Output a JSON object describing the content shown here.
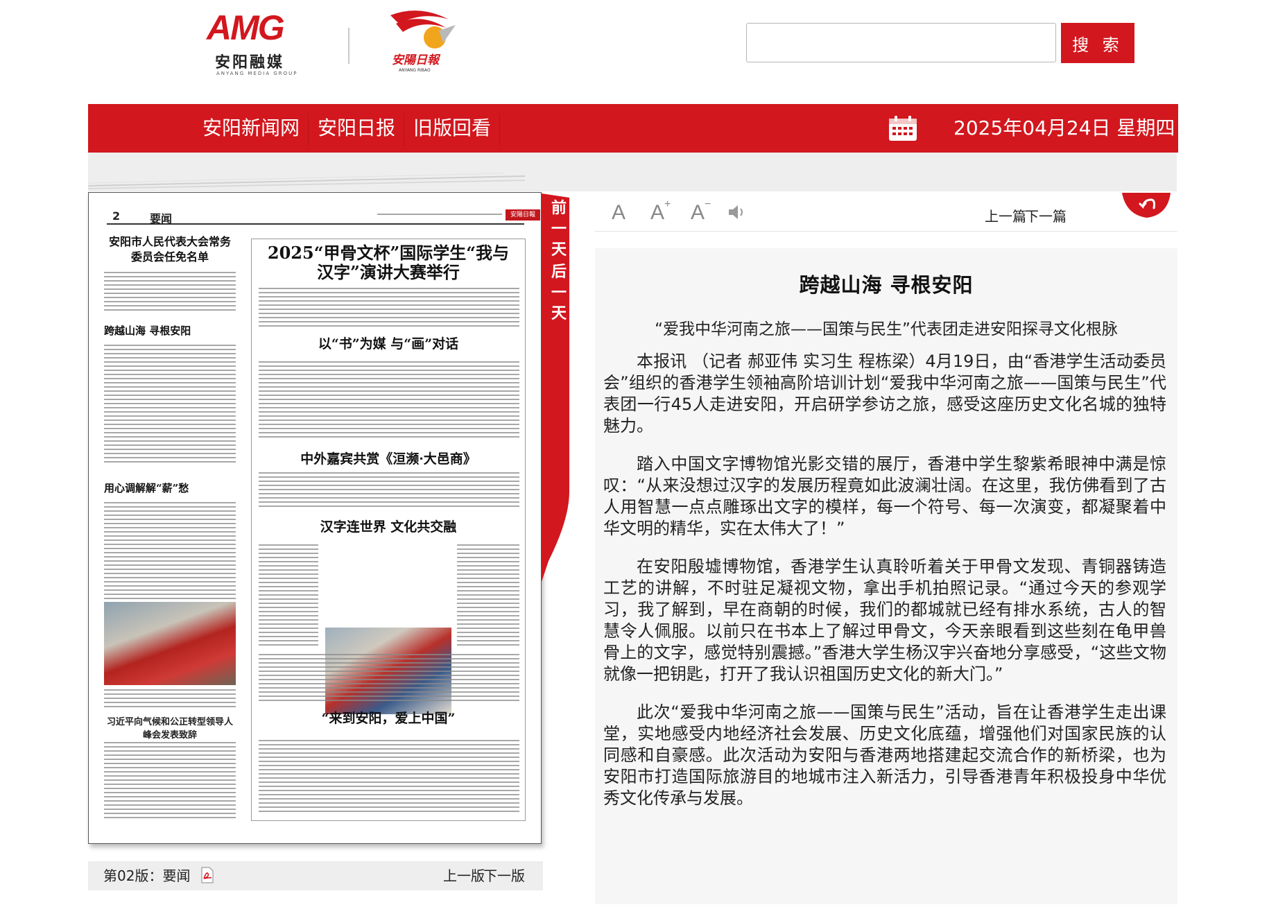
{
  "header": {
    "logo_amg_mark": "AMG",
    "logo_amg_cn": "安阳融媒",
    "logo_amg_en": "ANYANG MEDIA GROUP",
    "logo_ribao_cn": "安陽日報",
    "logo_ribao_en": "ANYANG RIBAO",
    "search_placeholder": "",
    "search_button": "搜 索"
  },
  "nav": {
    "items": [
      "安阳新闻网",
      "安阳日报",
      "旧版回看"
    ],
    "date": "2025年04月24日 星期四",
    "calendar_icon": "calendar-icon"
  },
  "side_tab": {
    "prev_day": [
      "前",
      "一",
      "天"
    ],
    "next_day": [
      "后",
      "一",
      "天"
    ]
  },
  "newspaper": {
    "page_num": "2",
    "section": "要闻",
    "left_headline_1": "安阳市人民代表大会常务委员会任免名单",
    "left_headline_2": "跨越山海 寻根安阳",
    "left_headline_3": "用心调解解“薪”愁",
    "left_headline_4": "习近平向气候和公正转型领导人峰会发表致辞",
    "box_headline_1": "2025“甲骨文杯”国际学生“我与汉字”演讲大赛举行",
    "box_headline_2": "以“书”为媒 与“画”对话",
    "box_headline_3": "中外嘉宾共赏《洹濒·大邑商》",
    "box_headline_4": "汉字连世界 文化共交融",
    "box_headline_5": "“来到安阳，爱上中国”",
    "colors": {
      "accent": "#d2171e"
    }
  },
  "page_footer": {
    "label": "第02版：要闻",
    "pdf_icon": "pdf-icon",
    "prev": "上一版",
    "next": "下一版"
  },
  "article_tools": {
    "font_default": "A",
    "font_larger": "A",
    "font_larger_sup": "+",
    "font_smaller": "A",
    "font_smaller_sup": "−",
    "speaker_icon": "speaker-icon",
    "prev": "上一篇",
    "next": "下一篇",
    "back_icon": "back-arrow-icon"
  },
  "article": {
    "title": "跨越山海 寻根安阳",
    "subtitle": "“爱我中华河南之旅——国策与民生”代表团走进安阳探寻文化根脉",
    "paragraphs": [
      "本报讯 （记者 郝亚伟 实习生 程栋梁）4月19日，由“香港学生活动委员会”组织的香港学生领袖高阶培训计划“爱我中华河南之旅——国策与民生”代表团一行45人走进安阳，开启研学参访之旅，感受这座历史文化名城的独特魅力。",
      "踏入中国文字博物馆光影交错的展厅，香港中学生黎紫希眼神中满是惊叹：“从来没想过汉字的发展历程竟如此波澜壮阔。在这里，我仿佛看到了古人用智慧一点点雕琢出文字的模样，每一个符号、每一次演变，都凝聚着中华文明的精华，实在太伟大了！”",
      "在安阳殷墟博物馆，香港学生认真聆听着关于甲骨文发现、青铜器铸造工艺的讲解，不时驻足凝视文物，拿出手机拍照记录。“通过今天的参观学习，我了解到，早在商朝的时候，我们的都城就已经有排水系统，古人的智慧令人佩服。以前只在书本上了解过甲骨文，今天亲眼看到这些刻在龟甲兽骨上的文字，感觉特别震撼。”香港大学生杨汉宇兴奋地分享感受，“这些文物就像一把钥匙，打开了我认识祖国历史文化的新大门。”",
      "此次“爱我中华河南之旅——国策与民生”活动，旨在让香港学生走出课堂，实地感受内地经济社会发展、历史文化底蕴，增强他们对国家民族的认同感和自豪感。此次活动为安阳与香港两地搭建起交流合作的新桥梁，也为安阳市打造国际旅游目的地城市注入新活力，引导香港青年积极投身中华优秀文化传承与发展。"
    ]
  }
}
